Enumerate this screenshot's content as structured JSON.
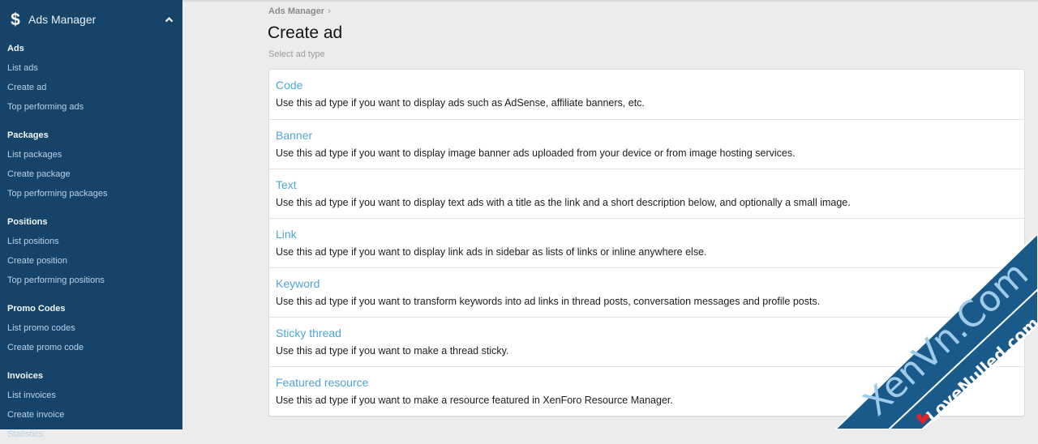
{
  "sidebar": {
    "header": {
      "icon": "dollar-icon",
      "title": "Ads Manager",
      "toggle_icon": "chevron-up-icon"
    },
    "groups": [
      {
        "title": "Ads",
        "items": [
          "List ads",
          "Create ad",
          "Top performing ads"
        ]
      },
      {
        "title": "Packages",
        "items": [
          "List packages",
          "Create package",
          "Top performing packages"
        ]
      },
      {
        "title": "Positions",
        "items": [
          "List positions",
          "Create position",
          "Top performing positions"
        ]
      },
      {
        "title": "Promo Codes",
        "items": [
          "List promo codes",
          "Create promo code"
        ]
      },
      {
        "title": "Invoices",
        "items": [
          "List invoices",
          "Create invoice",
          "Statistics"
        ]
      }
    ]
  },
  "main": {
    "breadcrumb": {
      "label": "Ads Manager",
      "separator": "›"
    },
    "title": "Create ad",
    "description": "Select ad type",
    "ad_types": [
      {
        "name": "Code",
        "description": "Use this ad type if you want to display ads such as AdSense, affiliate banners, etc."
      },
      {
        "name": "Banner",
        "description": "Use this ad type if you want to display image banner ads uploaded from your device or from image hosting services."
      },
      {
        "name": "Text",
        "description": "Use this ad type if you want to display text ads with a title as the link and a short description below, and optionally a small image."
      },
      {
        "name": "Link",
        "description": "Use this ad type if you want to display link ads in sidebar as lists of links or inline anywhere else."
      },
      {
        "name": "Keyword",
        "description": "Use this ad type if you want to transform keywords into ad links in thread posts, conversation messages and profile posts."
      },
      {
        "name": "Sticky thread",
        "description": "Use this ad type if you want to make a thread sticky."
      },
      {
        "name": "Featured resource",
        "description": "Use this ad type if you want to make a resource featured in XenForo Resource Manager."
      }
    ]
  },
  "watermark": {
    "primary": "XenVn.Com",
    "secondary": "LoveNulled.com",
    "icon": "heart-icon"
  },
  "colors": {
    "sidebar_bg": "#164468",
    "link": "#4da6d6",
    "page_bg": "#ececec"
  }
}
